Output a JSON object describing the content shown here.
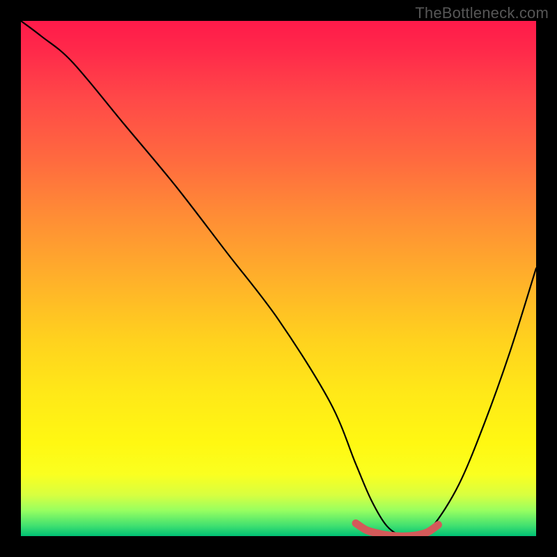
{
  "watermark": "TheBottleneck.com",
  "chart_data": {
    "type": "line",
    "title": "",
    "xlabel": "",
    "ylabel": "",
    "xlim": [
      0,
      100
    ],
    "ylim": [
      0,
      100
    ],
    "series": [
      {
        "name": "bottleneck-curve",
        "color": "#000000",
        "x": [
          0,
          4,
          10,
          20,
          30,
          40,
          50,
          60,
          65,
          68,
          71,
          74,
          77,
          80,
          85,
          90,
          95,
          100
        ],
        "values": [
          100,
          97,
          92,
          80,
          68,
          55,
          42,
          26,
          14,
          7,
          2,
          0,
          0,
          2,
          10,
          22,
          36,
          52
        ]
      },
      {
        "name": "optimal-range-marker",
        "color": "#d45a5a",
        "x": [
          65,
          67,
          69,
          71,
          73,
          75,
          77,
          79,
          81
        ],
        "values": [
          2.5,
          1.2,
          0.6,
          0.2,
          0.0,
          0.0,
          0.2,
          0.8,
          2.2
        ]
      }
    ],
    "gradient_stops": [
      {
        "pos": 0,
        "color": "#ff1a4a"
      },
      {
        "pos": 15,
        "color": "#ff4848"
      },
      {
        "pos": 37,
        "color": "#ff8a36"
      },
      {
        "pos": 62,
        "color": "#ffd21e"
      },
      {
        "pos": 82,
        "color": "#fff812"
      },
      {
        "pos": 95,
        "color": "#98ff60"
      },
      {
        "pos": 100,
        "color": "#00c074"
      }
    ]
  }
}
